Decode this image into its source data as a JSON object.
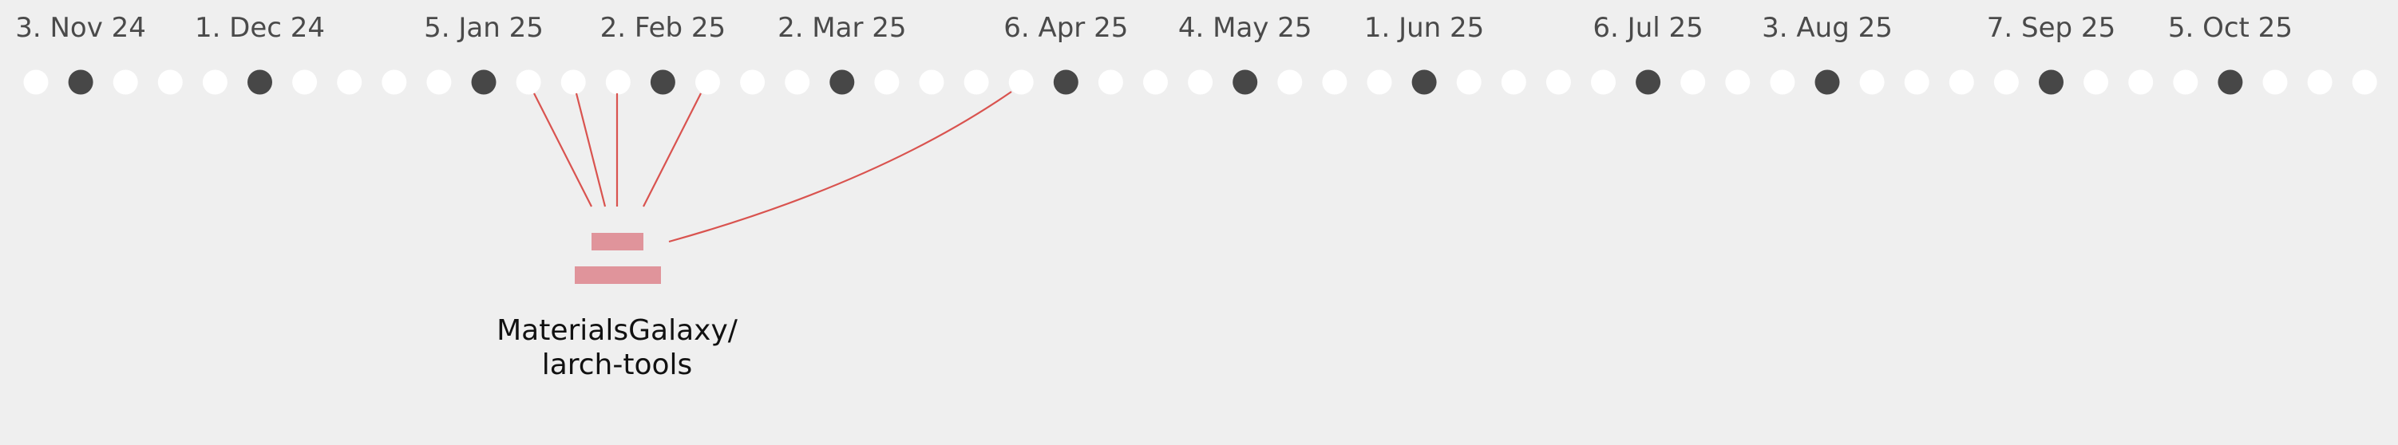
{
  "timeline": {
    "months": [
      {
        "label": "3. Nov 24"
      },
      {
        "label": "1. Dec 24"
      },
      {
        "label": "5. Jan 25"
      },
      {
        "label": "2. Feb 25"
      },
      {
        "label": "2. Mar 25"
      },
      {
        "label": "6. Apr 25"
      },
      {
        "label": "4. May 25"
      },
      {
        "label": "1. Jun 25"
      },
      {
        "label": "6. Jul 25"
      },
      {
        "label": "3. Aug 25"
      },
      {
        "label": "7. Sep 25"
      },
      {
        "label": "5. Oct 25"
      }
    ],
    "week_count": 53,
    "colors": {
      "background": "#efefef",
      "week_dot": "#ffffff",
      "month_dot": "#474747",
      "connector": "#d9534f",
      "repo_icon": "#e0949b",
      "label_text": "#4a4a4a",
      "repo_text": "#111111"
    }
  },
  "repository": {
    "name_line1": "MaterialsGalaxy/",
    "name_line2": "larch-tools",
    "icon": "repository-icon"
  }
}
